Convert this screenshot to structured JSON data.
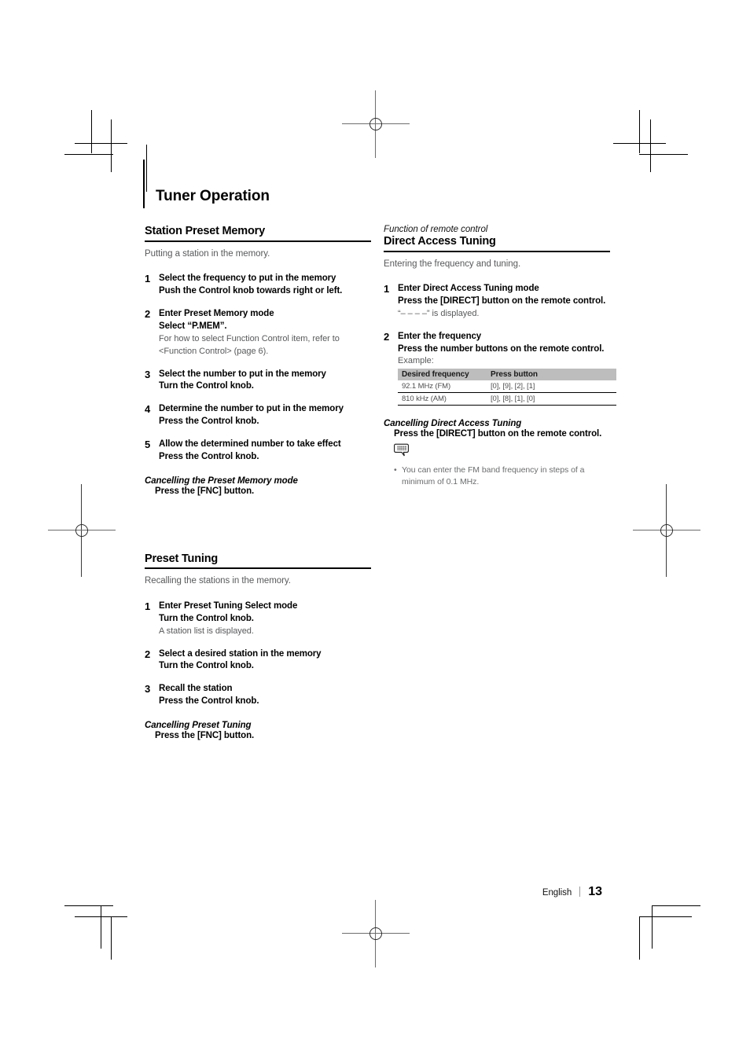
{
  "page": {
    "chapter_title": "Tuner Operation",
    "footer": {
      "language": "English",
      "separator": "|",
      "page_number": "13"
    }
  },
  "left_column": {
    "sections": [
      {
        "heading": "Station Preset Memory",
        "lead": "Putting a station in the memory.",
        "steps": [
          {
            "num": "1",
            "title": "Select the frequency to put in the memory",
            "action": "Push the Control knob towards right or left."
          },
          {
            "num": "2",
            "title": "Enter Preset Memory mode",
            "action": "Select “P.MEM”.",
            "note": "For how to select Function Control item, refer to <Function Control> (page 6)."
          },
          {
            "num": "3",
            "title": "Select the number to put in the memory",
            "action": "Turn the Control knob."
          },
          {
            "num": "4",
            "title": "Determine the number to put in the memory",
            "action": "Press the Control knob."
          },
          {
            "num": "5",
            "title": "Allow the determined number to take effect",
            "action": "Press the Control knob."
          }
        ],
        "cancel": {
          "heading": "Cancelling the Preset Memory mode",
          "action": "Press the [FNC] button."
        }
      },
      {
        "heading": "Preset Tuning",
        "lead": "Recalling the stations in the memory.",
        "steps": [
          {
            "num": "1",
            "title": "Enter Preset Tuning Select mode",
            "action": "Turn the Control knob.",
            "note": "A station list is displayed."
          },
          {
            "num": "2",
            "title": "Select a desired station in the memory",
            "action": "Turn the Control knob."
          },
          {
            "num": "3",
            "title": "Recall the station",
            "action": "Press the Control knob."
          }
        ],
        "cancel": {
          "heading": "Cancelling Preset Tuning",
          "action": "Press the [FNC] button."
        }
      }
    ]
  },
  "right_column": {
    "overline": "Function of remote control",
    "heading": "Direct Access Tuning",
    "lead": "Entering the frequency and tuning.",
    "steps": [
      {
        "num": "1",
        "title": "Enter Direct Access Tuning mode",
        "action": "Press the [DIRECT] button on the remote control.",
        "note": "“– – – –” is displayed."
      },
      {
        "num": "2",
        "title": "Enter the frequency",
        "action": "Press the number buttons on the remote control.",
        "example_label": "Example:"
      }
    ],
    "example_table": {
      "headers": [
        "Desired frequency",
        "Press button"
      ],
      "rows": [
        [
          "92.1 MHz (FM)",
          "[0], [9], [2], [1]"
        ],
        [
          "810 kHz (AM)",
          "[0], [8], [1], [0]"
        ]
      ]
    },
    "cancel": {
      "heading": "Cancelling Direct Access Tuning",
      "action": "Press the [DIRECT] button on the remote control."
    },
    "memo": {
      "icon": "memo-bubble-icon",
      "bullet": "•",
      "text": "You can enter the FM band frequency in steps of a minimum of 0.1 MHz."
    }
  }
}
